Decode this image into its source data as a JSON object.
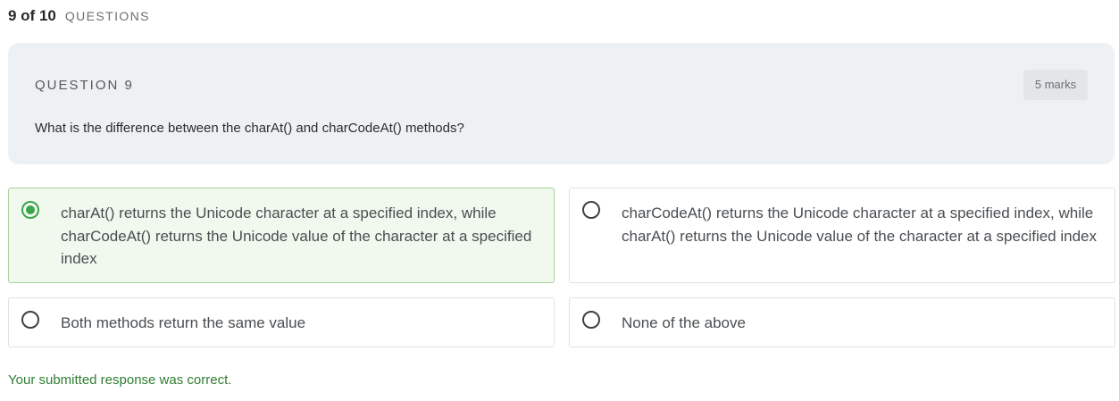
{
  "progress": {
    "count": "9 of 10",
    "label": "QUESTIONS"
  },
  "question": {
    "number_label": "QUESTION 9",
    "marks": "5 marks",
    "text": "What is the difference between the charAt() and charCodeAt() methods?"
  },
  "options": [
    {
      "text": "charAt() returns the Unicode character at a specified index, while charCodeAt() returns the Unicode value of the character at a specified index",
      "selected": true
    },
    {
      "text": "charCodeAt() returns the Unicode character at a specified index, while charAt() returns the Unicode value of the character at a specified index",
      "selected": false
    },
    {
      "text": "Both methods return the same value",
      "selected": false
    },
    {
      "text": "None of the above",
      "selected": false
    }
  ],
  "feedback": "Your submitted response was correct.",
  "colors": {
    "selected_background": "#f1f9ee",
    "selected_border": "#a8d59a",
    "radio_checked": "#3aa54a",
    "correct_text": "#2f7d32",
    "question_card_background": "#eef1f4"
  }
}
